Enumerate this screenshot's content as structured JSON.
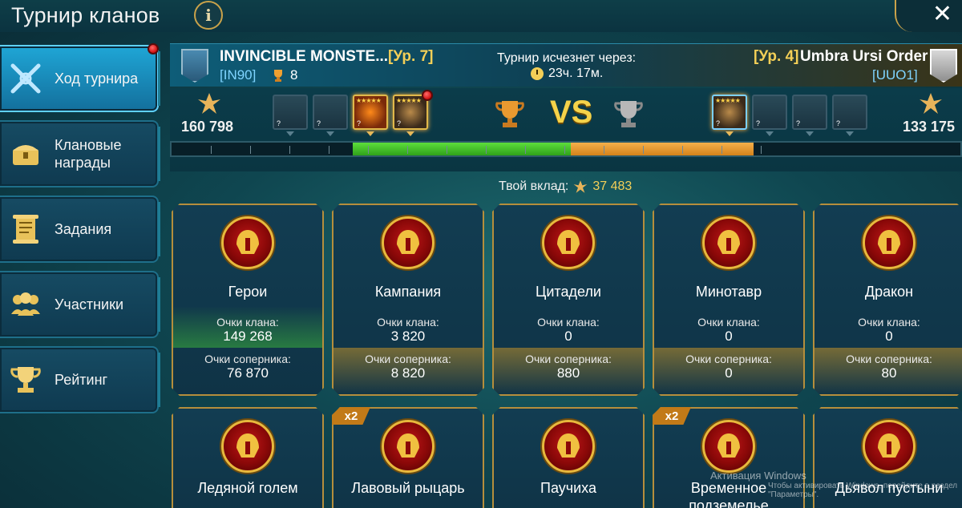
{
  "header": {
    "title": "Турнир кланов",
    "info_label": "i",
    "close_label": "✕"
  },
  "sidebar": {
    "items": [
      {
        "label": "Ход турнира",
        "icon": "crossed-swords-icon",
        "active": true
      },
      {
        "label": "Клановые награды",
        "icon": "treasure-chest-icon"
      },
      {
        "label": "Задания",
        "icon": "scroll-icon"
      },
      {
        "label": "Участники",
        "icon": "members-icon"
      },
      {
        "label": "Рейтинг",
        "icon": "trophy-icon"
      }
    ]
  },
  "clans": {
    "left": {
      "name": "INVINCIBLE MONSTE...",
      "level": "[Ур. 7]",
      "tag": "[IN90]",
      "rank": "8",
      "score": "160 798"
    },
    "right": {
      "name": "Umbra Ursi Order",
      "level": "[Ур. 4]",
      "tag": "[UUO1]",
      "score": "133 175"
    }
  },
  "timer": {
    "label": "Турнир исчезнет через:",
    "value": "23ч. 17м."
  },
  "vs_label": "VS",
  "contribution": {
    "label": "Твой вклад:",
    "value": "37 483"
  },
  "progress": {
    "left_share": 0.55,
    "right_share": 0.45
  },
  "cards": [
    {
      "name": "Герои",
      "clan_label": "Очки клана:",
      "clan_pts": "149 268",
      "opp_label": "Очки соперника:",
      "opp_pts": "76 870",
      "icon": "spartan-helmet-icon"
    },
    {
      "name": "Кампания",
      "clan_label": "Очки клана:",
      "clan_pts": "3 820",
      "opp_label": "Очки соперника:",
      "opp_pts": "8 820",
      "icon": "crown-icon"
    },
    {
      "name": "Цитадели",
      "clan_label": "Очки клана:",
      "clan_pts": "0",
      "opp_label": "Очки соперника:",
      "opp_pts": "880",
      "icon": "potions-icon"
    },
    {
      "name": "Минотавр",
      "clan_label": "Очки клана:",
      "clan_pts": "0",
      "opp_label": "Очки соперника:",
      "opp_pts": "0",
      "icon": "minotaur-icon"
    },
    {
      "name": "Дракон",
      "clan_label": "Очки клана:",
      "clan_pts": "0",
      "opp_label": "Очки соперника:",
      "opp_pts": "80",
      "icon": "dragon-icon"
    }
  ],
  "cards_bottom": [
    {
      "name": "Ледяной голем",
      "icon": "ice-golem-icon"
    },
    {
      "name": "Лавовый рыцарь",
      "icon": "lava-knight-icon",
      "badge": "x2"
    },
    {
      "name": "Паучиха",
      "icon": "spider-icon"
    },
    {
      "name": "Временное подземелье",
      "icon": "temporary-dungeon-icon",
      "badge": "x2"
    },
    {
      "name": "Дьявол пустыни",
      "icon": "desert-devil-icon"
    }
  ],
  "watermark": {
    "line1": "Активация Windows",
    "line2": "Чтобы активировать Windows, перейдите в раздел \"Параметры\"."
  },
  "colors": {
    "accent_gold": "#f3cf57",
    "active_tab": "#1fa6d6",
    "clan_bar": "#5dde3c",
    "opponent_bar": "#f5b04a"
  }
}
